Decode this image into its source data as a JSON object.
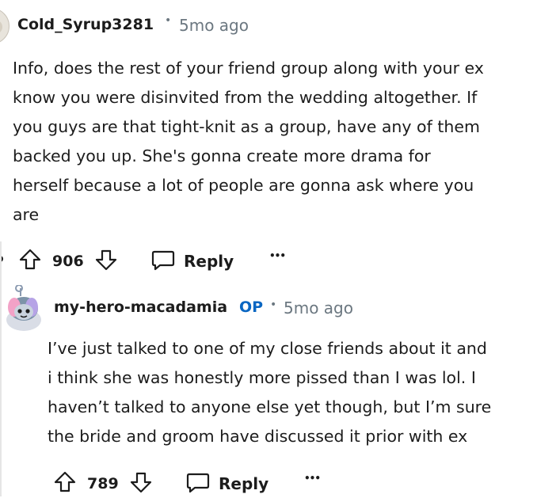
{
  "comment1": {
    "username": "Cold_Syrup3281",
    "separator": "•",
    "time": "5mo ago",
    "body_lines": [
      "Info, does the rest of your friend group along with your ex",
      "know you were disinvited from the wedding altogether. If",
      "you guys are that tight-knit as a group, have any of them",
      "backed you up. She's gonna create more drama for",
      "herself because a lot of people are gonna ask where you",
      "are"
    ],
    "votes": "906",
    "reply_label": "Reply",
    "more_label": "•••"
  },
  "comment2": {
    "username": "my-hero-macadamia",
    "op_badge": "OP",
    "separator": "•",
    "time": "5mo ago",
    "body_lines": [
      "I’ve just talked to one of my close friends about it and",
      "i think she was honestly more pissed than I was lol. I",
      "haven’t talked to anyone else yet though, but I’m sure",
      "the bride and groom have discussed it prior with ex"
    ],
    "votes": "789",
    "reply_label": "Reply",
    "more_label": "•••"
  },
  "icons": [
    "upvote-icon",
    "downvote-icon",
    "comment-icon",
    "more-icon",
    "avatar"
  ]
}
